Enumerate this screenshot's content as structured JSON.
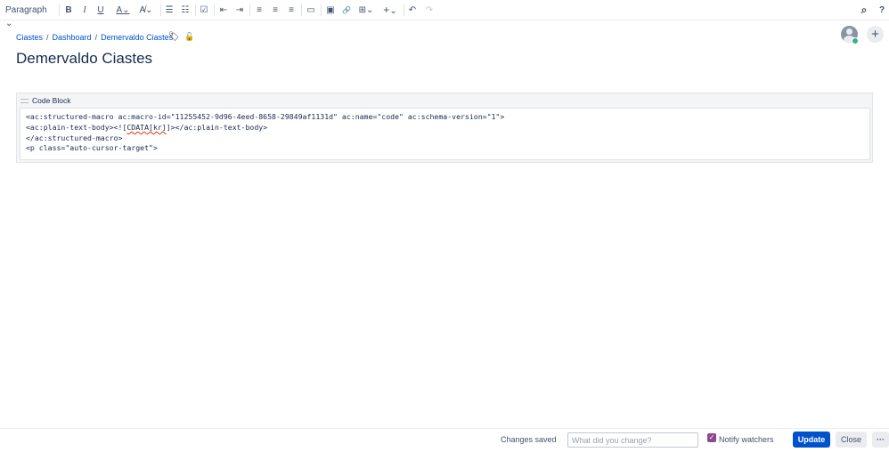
{
  "toolbar": {
    "paragraph": "Paragraph",
    "bold": "B",
    "italic": "I",
    "underline": "U",
    "text_color": "A",
    "more_format": "A̸",
    "bullet": "☰",
    "numbered": "☷",
    "task": "☑",
    "outdent": "⇤",
    "indent": "⇥",
    "align_left": "≡",
    "align_center": "≡",
    "align_right": "≡",
    "layout": "▭",
    "image": "▣",
    "link": "🔗",
    "table": "⊞",
    "insert": "+",
    "undo": "↶",
    "redo": "↷",
    "chevron": "⌄",
    "search": "⌕",
    "help": "?"
  },
  "breadcrumb": [
    "Ciastes",
    "Dashboard",
    "Demervaldo Ciastes"
  ],
  "page_title": "Demervaldo Ciastes",
  "code_block": {
    "title": "Code Block",
    "lines": [
      "<ac:structured-macro ac:macro-id=\"11255452-9d96-4eed-8658-29849af1131d\" ac:name=\"code\" ac:schema-version=\"1\">",
      "<ac:plain-text-body><![",
      "CDATA[kr]",
      "]></ac:plain-text-body>",
      "</ac:structured-macro>",
      "<p class=\"auto-cursor-target\">"
    ]
  },
  "footer": {
    "status": "Changes saved",
    "change_placeholder": "What did you change?",
    "notify_label": "Notify watchers",
    "notify_checked": true,
    "update": "Update",
    "close": "Close",
    "more": "···"
  },
  "colors": {
    "primary": "#0052cc",
    "link": "#0052cc",
    "checkbox": "#8c4a8c"
  }
}
